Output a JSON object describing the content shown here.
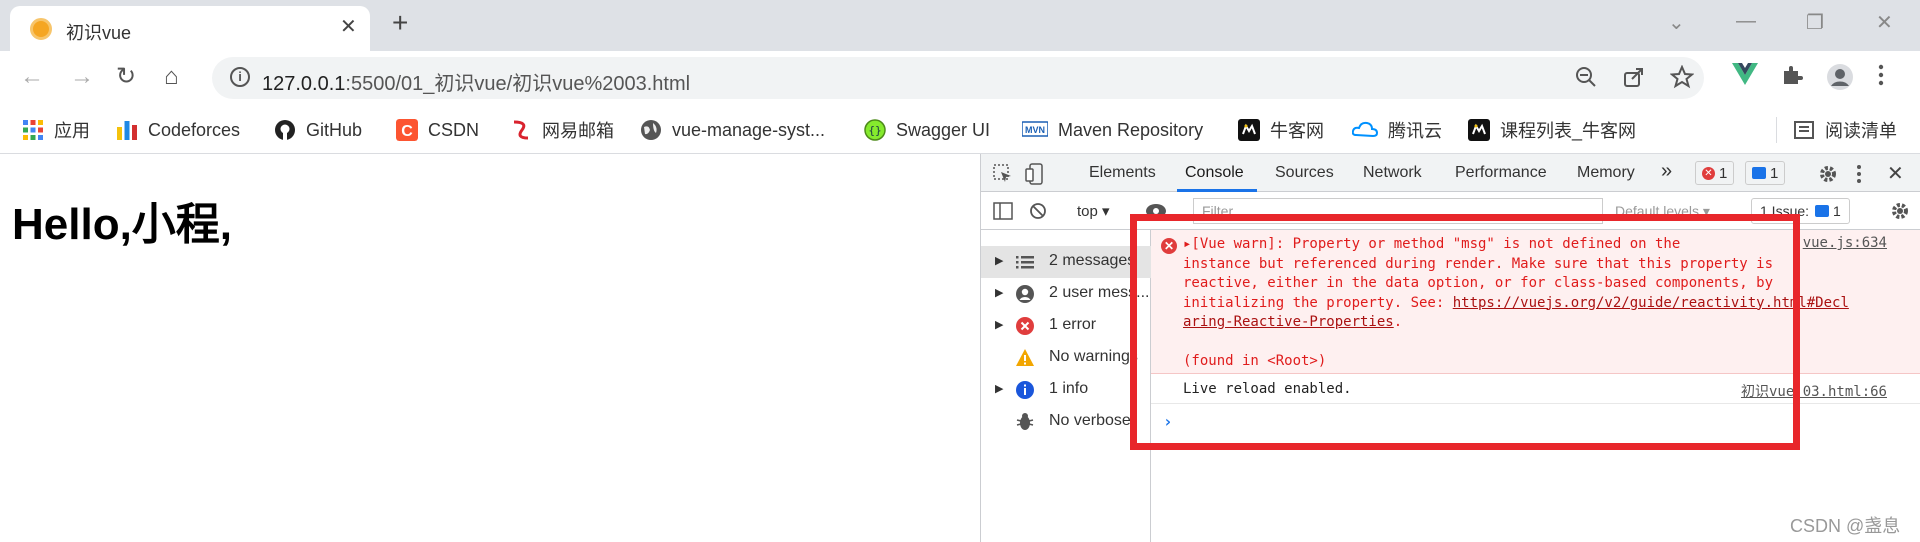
{
  "browser": {
    "tab_title": "初识vue",
    "tab_close": "✕",
    "new_tab": "+",
    "window_controls": {
      "minimize_list": "⌄",
      "minimize": "—",
      "restore": "❐",
      "close": "✕"
    },
    "nav": {
      "back": "←",
      "forward": "→",
      "reload": "↻",
      "home": "⌂"
    },
    "omnibox": {
      "host": "127.0.0.1",
      "path": ":5500/01_初识vue/初识vue%2003.html",
      "icons": [
        "zoom-out-icon",
        "share-icon",
        "star-icon"
      ]
    },
    "extensions": [
      "vue-devtools-icon",
      "puzzle-icon",
      "profile-icon",
      "menu-icon"
    ]
  },
  "bookmarks": [
    {
      "label": "应用",
      "icon": "apps-grid-icon",
      "color": "#4285f4"
    },
    {
      "label": "Codeforces",
      "icon": "codeforces-icon",
      "color": "#1e88e5"
    },
    {
      "label": "GitHub",
      "icon": "github-icon",
      "color": "#222222"
    },
    {
      "label": "CSDN",
      "icon": "csdn-icon",
      "color": "#fc5531"
    },
    {
      "label": "网易邮箱",
      "icon": "netease-mail-icon",
      "color": "#d9232e"
    },
    {
      "label": "vue-manage-syst...",
      "icon": "globe-icon",
      "color": "#555555"
    },
    {
      "label": "Swagger UI",
      "icon": "swagger-icon",
      "color": "#6a9a1f"
    },
    {
      "label": "Maven Repository",
      "icon": "maven-icon",
      "color": "#1a5fb4"
    },
    {
      "label": "牛客网",
      "icon": "nowcoder-icon",
      "color": "#000000"
    },
    {
      "label": "腾讯云",
      "icon": "tencent-cloud-icon",
      "color": "#0091ff"
    },
    {
      "label": "课程列表_牛客网",
      "icon": "nowcoder-icon",
      "color": "#000000"
    }
  ],
  "reading_list": "阅读清单",
  "page": {
    "heading": "Hello,小程,"
  },
  "devtools": {
    "tabs": [
      "Elements",
      "Console",
      "Sources",
      "Network",
      "Performance",
      "Memory"
    ],
    "active_tab": "Console",
    "more_tabs": "»",
    "error_badge": "1",
    "info_badge": "1",
    "toolbar": {
      "context": "top",
      "filter_placeholder": "Filter",
      "levels": "Default levels ▾",
      "issues": "1 Issue:",
      "issues_count": "1"
    },
    "sidebar": [
      {
        "label": "2 messages",
        "icon": "list-icon",
        "arrow": true,
        "selected": true
      },
      {
        "label": "2 user mess...",
        "icon": "user-icon",
        "arrow": true,
        "selected": false
      },
      {
        "label": "1 error",
        "icon": "error-icon",
        "arrow": true,
        "selected": false
      },
      {
        "label": "No warnings",
        "icon": "warning-icon",
        "arrow": false,
        "selected": false
      },
      {
        "label": "1 info",
        "icon": "info-icon",
        "arrow": true,
        "selected": false
      },
      {
        "label": "No verbose",
        "icon": "bug-icon",
        "arrow": false,
        "selected": false
      }
    ],
    "console": {
      "error": {
        "line1": "▸[Vue warn]: Property or method \"msg\" is not defined on the",
        "line2": "instance but referenced during render. Make sure that this property is",
        "line3": "reactive, either in the data option, or for class-based components, by",
        "line4_prefix": "initializing the property. See: ",
        "link_part1": "https://vuejs.org/v2/guide/reactivity.html#Decl",
        "link_part2": "aring-Reactive-Properties",
        "line5_suffix": ".",
        "found_in": "(found in <Root>)",
        "source": "vue.js:634"
      },
      "info": {
        "text": "Live reload enabled.",
        "source": "初识vue 03.html:66"
      },
      "prompt": "›"
    }
  },
  "watermark": "CSDN @盏息",
  "colors": {
    "highlight_frame": "#e8272b",
    "error_text": "#e01c1c",
    "accent": "#1a73e8"
  }
}
